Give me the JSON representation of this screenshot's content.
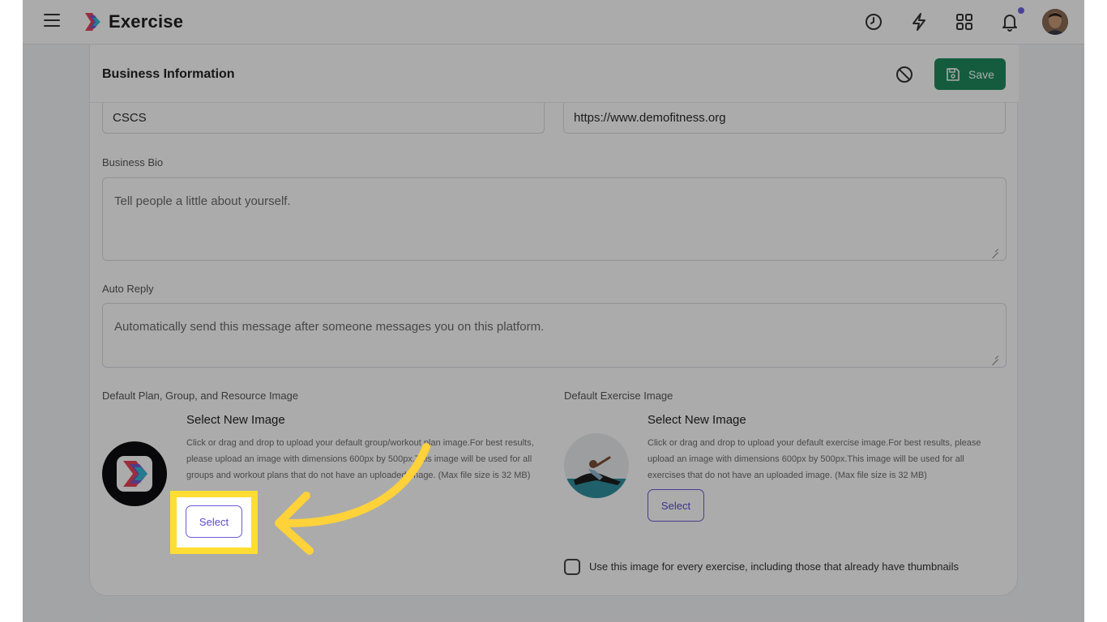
{
  "app": {
    "name": "Exercise"
  },
  "topbar": {
    "icons": [
      "menu-icon",
      "clock-icon",
      "bolt-icon",
      "grid-icon",
      "bell-icon"
    ],
    "notification_dot_color": "#6e63e8"
  },
  "card": {
    "title": "Business Information",
    "save_label": "Save",
    "accent_color": "#1f8a5c"
  },
  "fields": {
    "credentials_value": "CSCS",
    "website_value": "https://www.demofitness.org",
    "bio_label": "Business Bio",
    "bio_placeholder": "Tell people a little about yourself.",
    "auto_reply_label": "Auto Reply",
    "auto_reply_placeholder": "Automatically send this message after someone messages you on this platform."
  },
  "plan_image": {
    "section_label": "Default Plan, Group, and Resource Image",
    "title": "Select New Image",
    "description": "Click or drag and drop to upload your default group/workout plan image.For best results, please upload an image with dimensions 600px by 500px.This image will be used for all groups and workout plans that do not have an uploaded image. (Max file size is 32 MB)",
    "button_label": "Select"
  },
  "exercise_image": {
    "section_label": "Default Exercise Image",
    "title": "Select New Image",
    "description": "Click or drag and drop to upload your default exercise image.For best results, please upload an image with dimensions 600px by 500px.This image will be used for all exercises that do not have an uploaded image. (Max file size is 32 MB)",
    "button_label": "Select",
    "apply_all_label": "Use this image for every exercise, including those that already have thumbnails",
    "apply_all_checked": false
  },
  "annotation": {
    "highlight_color": "#ffdd33"
  }
}
